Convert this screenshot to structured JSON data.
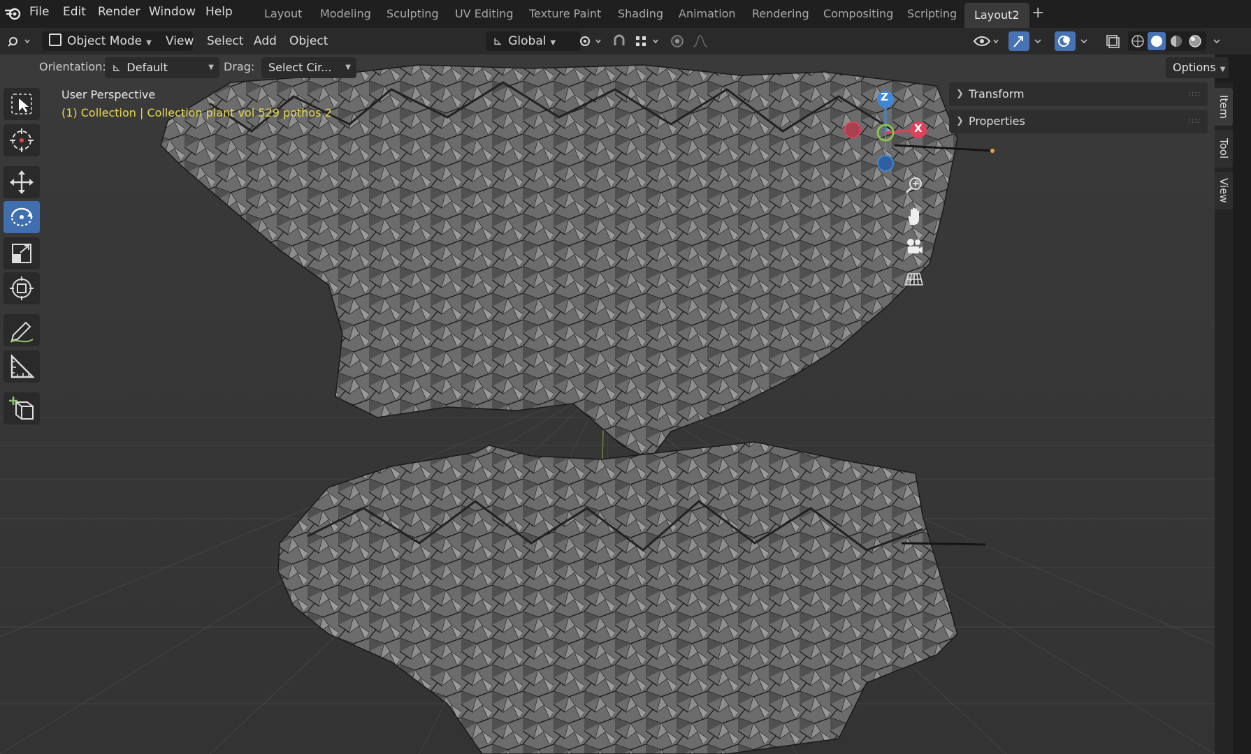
{
  "menubar": {
    "items": [
      "File",
      "Edit",
      "Render",
      "Window",
      "Help"
    ],
    "workspaces": [
      "Layout",
      "Modeling",
      "Sculpting",
      "UV Editing",
      "Texture Paint",
      "Shading",
      "Animation",
      "Rendering",
      "Compositing",
      "Scripting",
      "Layout2"
    ],
    "active_workspace": "Layout2",
    "add_tab": "+"
  },
  "header": {
    "mode": "Object Mode",
    "menus": [
      "View",
      "Select",
      "Add",
      "Object"
    ],
    "transform_orientation": "Global"
  },
  "tool_header": {
    "orientation_label": "Orientation:",
    "orientation_value": "Default",
    "drag_label": "Drag:",
    "drag_value": "Select Cir...",
    "options_label": "Options"
  },
  "viewport": {
    "title": "User Perspective",
    "collection": "(1) Collection | Collection plant vol 529 pothos 2",
    "gizmo": {
      "z": "Z",
      "x": "X"
    }
  },
  "sidebar": {
    "panels": [
      "Transform",
      "Properties"
    ],
    "tabs": [
      "Item",
      "Tool",
      "View"
    ]
  },
  "colors": {
    "accent": "#4772b3",
    "active_tool": "#3f6fae",
    "gizmo_x": "#e0405a",
    "gizmo_y": "#8bc34a",
    "gizmo_z": "#3f88d6",
    "overlay_text": "#e9d94a"
  },
  "icons": {
    "blender_logo": "blender-logo-icon",
    "tools": [
      "select-box-icon",
      "cursor-icon",
      "move-icon",
      "rotate-icon",
      "scale-icon",
      "transform-icon",
      "annotate-icon",
      "measure-icon",
      "add-cube-icon"
    ],
    "nav": [
      "zoom-icon",
      "pan-hand-icon",
      "camera-icon",
      "grid-icon"
    ]
  }
}
